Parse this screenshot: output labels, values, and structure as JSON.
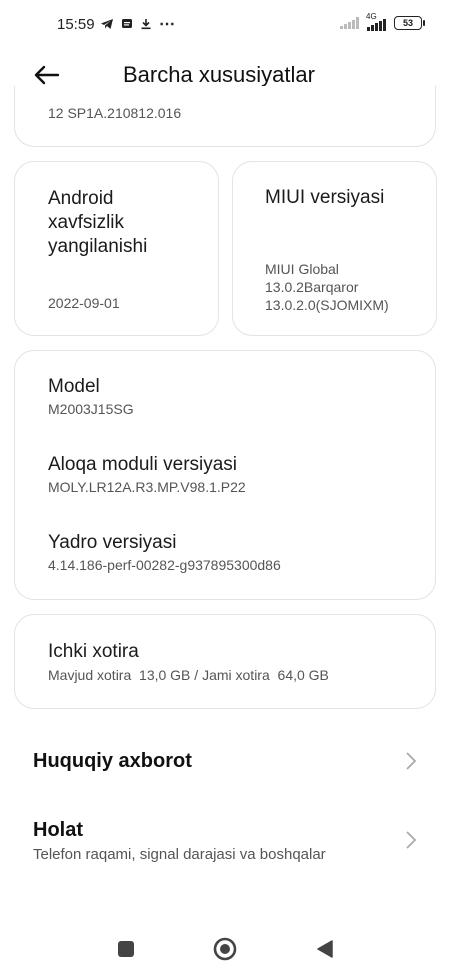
{
  "status_bar": {
    "time": "15:59",
    "more": "⋯",
    "network": "4G",
    "battery": "53"
  },
  "header": {
    "title": "Barcha xususiyatlar"
  },
  "top_card": {
    "value": "12 SP1A.210812.016"
  },
  "android_card": {
    "label": "Android xavfsizlik yangilanishi",
    "value": "2022-09-01"
  },
  "miui_card": {
    "label": "MIUI versiyasi",
    "value": "MIUI Global 13.0.2Barqaror 13.0.2.0(SJOMIXM)"
  },
  "device_card": {
    "items": [
      {
        "label": "Model",
        "value": "M2003J15SG"
      },
      {
        "label": "Aloqa moduli versiyasi",
        "value": "MOLY.LR12A.R3.MP.V98.1.P22"
      },
      {
        "label": "Yadro versiyasi",
        "value": "4.14.186-perf-00282-g937895300d86"
      }
    ]
  },
  "storage_card": {
    "label": "Ichki xotira",
    "value": "Mavjud xotira  13,0 GB / Jami xotira  64,0 GB"
  },
  "list": {
    "legal": {
      "title": "Huquqiy axborot"
    },
    "status": {
      "title": "Holat",
      "subtitle": "Telefon raqami, signal darajasi va boshqalar"
    }
  },
  "icons": {
    "back": "arrow-left-icon",
    "chevron": "chevron-right-icon",
    "nav_recents": "square-icon",
    "nav_home": "circle-icon",
    "nav_back": "triangle-back-icon"
  }
}
